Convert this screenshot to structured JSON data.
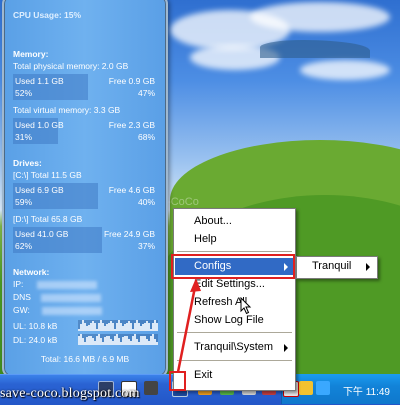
{
  "sidebar": {
    "cpu_usage": "CPU Usage: 15%",
    "memory": {
      "title": "Memory:",
      "physical_total": "Total physical memory: 2.0 GB",
      "physical": {
        "used": "Used 1.1 GB",
        "used_pct": "52%",
        "free": "Free 0.9 GB",
        "free_pct": "47%",
        "fill": 0.52
      },
      "virtual_total": "Total virtual memory: 3.3 GB",
      "virtual": {
        "used": "Used 1.0 GB",
        "used_pct": "31%",
        "free": "Free 2.3 GB",
        "free_pct": "68%",
        "fill": 0.31
      }
    },
    "drives": {
      "title": "Drives:",
      "c_label": "[C:\\] Total 11.5 GB",
      "c": {
        "used": "Used 6.9 GB",
        "used_pct": "59%",
        "free": "Free 4.6 GB",
        "free_pct": "40%",
        "fill": 0.59
      },
      "d_label": "[D:\\] Total 65.8 GB",
      "d": {
        "used": "Used 41.0 GB",
        "used_pct": "62%",
        "free": "Free 24.9 GB",
        "free_pct": "37%",
        "fill": 0.62
      }
    },
    "network": {
      "title": "Network:",
      "ip": "IP:",
      "dns": "DNS",
      "gw": "GW:",
      "ul": "UL: 10.8 kB",
      "dl": "DL: 24.0 kB",
      "total": "Total: 16.6 MB / 6.9 MB"
    }
  },
  "context_menu": {
    "items": [
      "About...",
      "Help",
      "Configs",
      "Edit Settings...",
      "Refresh All",
      "Show Log File",
      "Tranquil\\System",
      "Exit"
    ],
    "submenu": [
      "Tranquil"
    ]
  },
  "taskbar": {
    "clock": "下午 11:49",
    "watermark": "save-coco.blogspot.com"
  },
  "watermark_center": "Save-CoCo",
  "colors": {
    "menu_highlight": "#316ac5",
    "annotation_red": "#e02020",
    "taskbar": "#2356c8"
  }
}
